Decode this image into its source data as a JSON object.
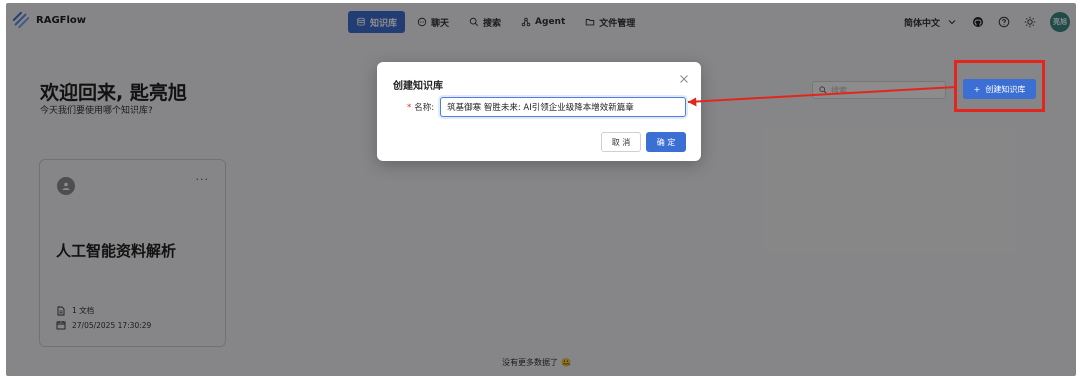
{
  "brand": {
    "name": "RAGFlow"
  },
  "nav": [
    {
      "label": "知识库",
      "icon": "database-icon",
      "active": true
    },
    {
      "label": "聊天",
      "icon": "chat-icon",
      "active": false
    },
    {
      "label": "搜索",
      "icon": "search-icon",
      "active": false
    },
    {
      "label": "Agent",
      "icon": "agent-graph-icon",
      "active": false
    },
    {
      "label": "文件管理",
      "icon": "folder-icon",
      "active": false
    }
  ],
  "header": {
    "language": "简体中文",
    "avatar_text": "亮旭"
  },
  "welcome": {
    "title": "欢迎回来, 匙亮旭",
    "subtitle": "今天我们要使用哪个知识库?"
  },
  "search": {
    "placeholder": "搜索"
  },
  "create_button": {
    "label": "创建知识库"
  },
  "cards": [
    {
      "title": "人工智能资料解析",
      "docs": "1 文档",
      "date": "27/05/2025 17:30:29",
      "more": "···"
    }
  ],
  "footer": {
    "text": "没有更多数据了",
    "emoji": "🤐"
  },
  "modal": {
    "title": "创建知识库",
    "field_label": "名称:",
    "field_value": "筑基御寒 智胜未来: AI引领企业级降本增效新篇章",
    "cancel_label": "取 消",
    "ok_label": "确 定"
  },
  "colors": {
    "accent": "#3c6fd4",
    "highlight": "#e3261d"
  }
}
